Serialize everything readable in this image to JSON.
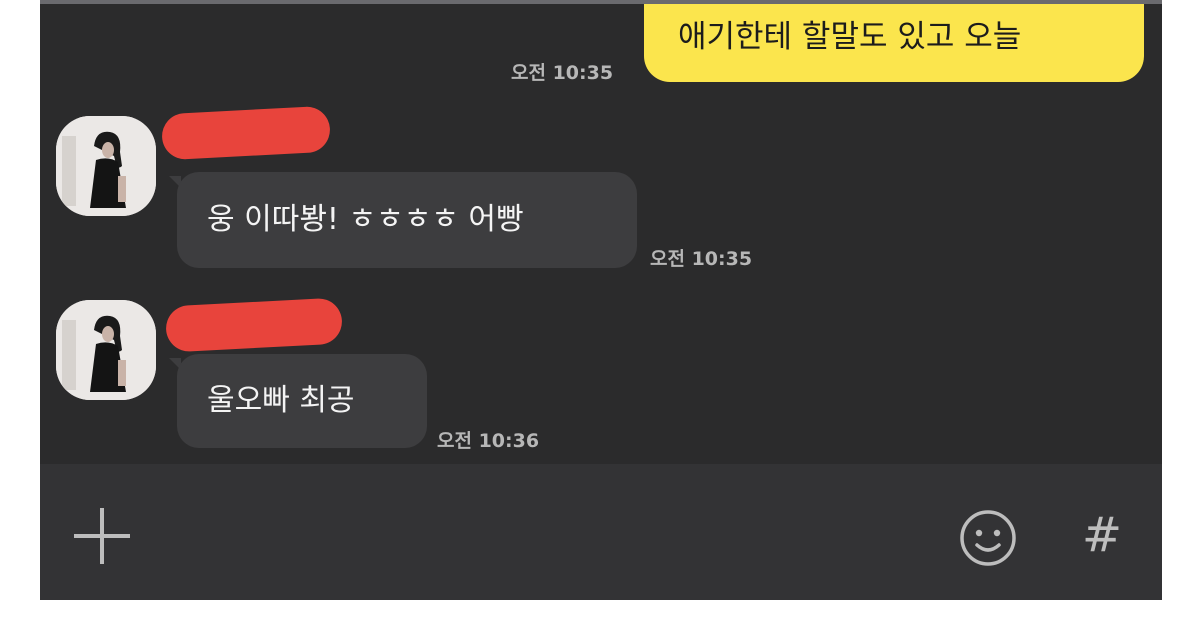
{
  "messages": [
    {
      "direction": "outgoing",
      "text": "애기한테 할말도 있고 오늘",
      "time": "오전 10:35"
    },
    {
      "direction": "incoming",
      "text": "웅 이따봥! ㅎㅎㅎㅎ 어빵",
      "time": "오전 10:35"
    },
    {
      "direction": "incoming",
      "text": "울오빠 최공",
      "time": "오전 10:36"
    }
  ],
  "input_bar": {
    "plus_icon": "plus-icon",
    "emoji_icon": "smiley-icon",
    "hash_icon": "hash-icon",
    "hash_glyph": "#"
  },
  "colors": {
    "chat_background": "#2b2b2c",
    "outgoing_bubble": "#fbe54d",
    "incoming_bubble": "#3d3d3f",
    "redaction": "#e8443c",
    "timestamp": "#b7b7b7"
  }
}
